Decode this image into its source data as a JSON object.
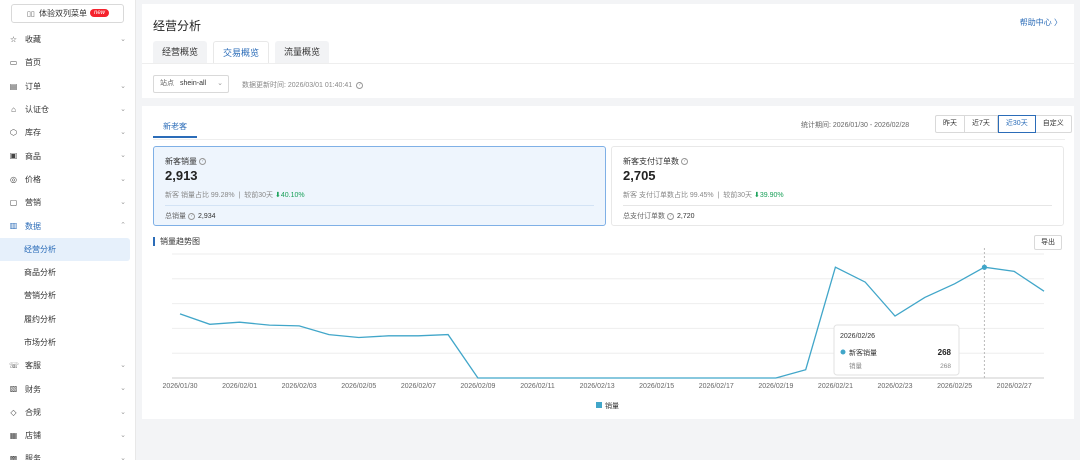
{
  "sidebar": {
    "dual_menu_label": "体验双列菜单",
    "dual_menu_badge": "new",
    "items": [
      {
        "label": "收藏",
        "icon": "star-icon",
        "glyph": "☆",
        "chevron": true
      },
      {
        "label": "首页",
        "icon": "monitor-icon",
        "glyph": "▭",
        "chevron": false
      },
      {
        "label": "订单",
        "icon": "order-icon",
        "glyph": "▤",
        "chevron": true
      },
      {
        "label": "认证仓",
        "icon": "warehouse-icon",
        "glyph": "⌂",
        "chevron": true
      },
      {
        "label": "库存",
        "icon": "inventory-icon",
        "glyph": "⬡",
        "chevron": true
      },
      {
        "label": "商品",
        "icon": "product-icon",
        "glyph": "▣",
        "chevron": true
      },
      {
        "label": "价格",
        "icon": "price-icon",
        "glyph": "◎",
        "chevron": true
      },
      {
        "label": "营销",
        "icon": "marketing-icon",
        "glyph": "▢",
        "chevron": true
      },
      {
        "label": "数据",
        "icon": "data-icon",
        "glyph": "▥",
        "chevron": true,
        "expanded": true
      },
      {
        "label": "经营分析",
        "sub": true,
        "active": true
      },
      {
        "label": "商品分析",
        "sub": true
      },
      {
        "label": "营销分析",
        "sub": true
      },
      {
        "label": "履约分析",
        "sub": true
      },
      {
        "label": "市场分析",
        "sub": true
      },
      {
        "label": "客服",
        "icon": "service-icon",
        "glyph": "☏",
        "chevron": true
      },
      {
        "label": "财务",
        "icon": "finance-icon",
        "glyph": "▧",
        "chevron": true
      },
      {
        "label": "合规",
        "icon": "compliance-icon",
        "glyph": "◇",
        "chevron": true
      },
      {
        "label": "店铺",
        "icon": "shop-icon",
        "glyph": "▦",
        "chevron": true
      },
      {
        "label": "服务",
        "icon": "services-icon",
        "glyph": "▩",
        "chevron": true
      }
    ]
  },
  "header": {
    "title": "经营分析",
    "help": "帮助中心 〉",
    "tabs": [
      {
        "label": "经营概览",
        "active": false
      },
      {
        "label": "交易概览",
        "active": true
      },
      {
        "label": "流量概览",
        "active": false
      }
    ],
    "site_label": "站点",
    "site_value": "shein-all",
    "update_time": "数据更新时间: 2026/03/01 01:40:41"
  },
  "main": {
    "sub_tab": "新老客",
    "period": "统计期间: 2026/01/30 - 2026/02/28",
    "ranges": [
      {
        "label": "昨天",
        "active": false
      },
      {
        "label": "近7天",
        "active": false
      },
      {
        "label": "近30天",
        "active": true
      },
      {
        "label": "自定义",
        "active": false
      }
    ],
    "kpis": [
      {
        "title": "新客销量",
        "value": "2,913",
        "ratio": "新客 销量占比 99.28%",
        "compare_label": "较前30天",
        "compare_value": "⬇40.10%",
        "total_label": "总销量",
        "total_value": "2,934",
        "active": true
      },
      {
        "title": "新客支付订单数",
        "value": "2,705",
        "ratio": "新客 支付订单数占比 99.45%",
        "compare_label": "较前30天",
        "compare_value": "⬇39.90%",
        "total_label": "总支付订单数",
        "total_value": "2,720",
        "active": false
      }
    ],
    "trend_title": "销量趋势图",
    "export": "导出"
  },
  "chart_data": {
    "type": "line",
    "x": [
      "2026/01/30",
      "2026/01/31",
      "2026/02/01",
      "2026/02/02",
      "2026/02/03",
      "2026/02/04",
      "2026/02/05",
      "2026/02/06",
      "2026/02/07",
      "2026/02/08",
      "2026/02/09",
      "2026/02/10",
      "2026/02/11",
      "2026/02/12",
      "2026/02/13",
      "2026/02/14",
      "2026/02/15",
      "2026/02/16",
      "2026/02/17",
      "2026/02/18",
      "2026/02/19",
      "2026/02/20",
      "2026/02/21",
      "2026/02/22",
      "2026/02/23",
      "2026/02/24",
      "2026/02/25",
      "2026/02/26",
      "2026/02/27",
      "2026/02/28"
    ],
    "tick_labels": [
      "2026/01/30",
      "2026/02/01",
      "2026/02/03",
      "2026/02/05",
      "2026/02/07",
      "2026/02/09",
      "2026/02/11",
      "2026/02/13",
      "2026/02/15",
      "2026/02/17",
      "2026/02/19",
      "2026/02/21",
      "2026/02/23",
      "2026/02/25",
      "2026/02/27"
    ],
    "series": [
      {
        "name": "销量",
        "color": "#41a6c9",
        "values": [
          155,
          130,
          135,
          128,
          126,
          105,
          98,
          102,
          102,
          105,
          0,
          0,
          0,
          0,
          0,
          0,
          0,
          0,
          0,
          0,
          0,
          20,
          268,
          232,
          150,
          195,
          228,
          268,
          258,
          210
        ]
      }
    ],
    "ylim": [
      0,
      300
    ],
    "grid": true,
    "legend": "bottom-center",
    "tooltip": {
      "date": "2026/02/26",
      "series_label": "新客销量",
      "series_value": "268",
      "row2_label": "销量",
      "row2_value": "268"
    }
  }
}
